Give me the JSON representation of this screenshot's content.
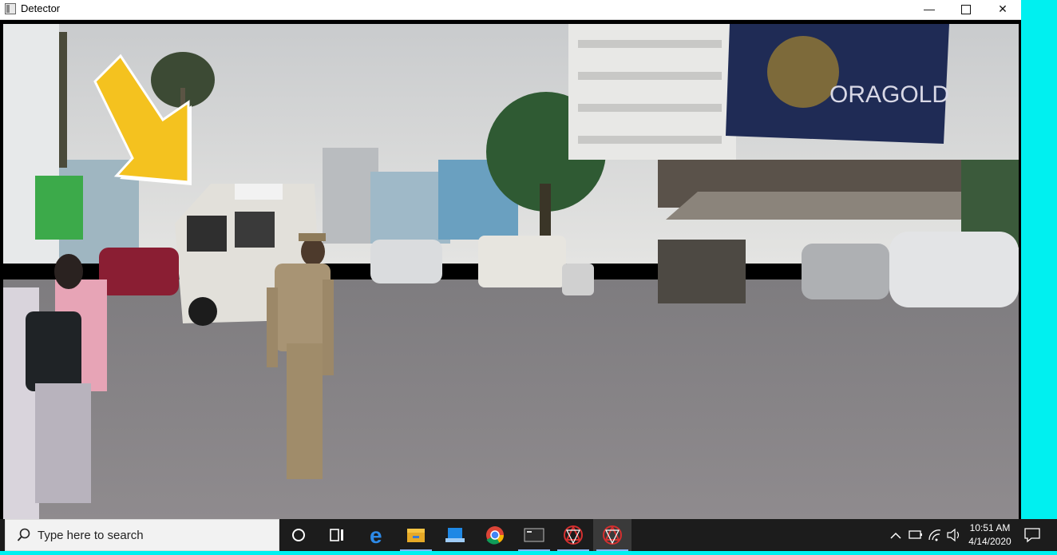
{
  "window": {
    "title": "Detector",
    "minimize_symbol": "—",
    "close_symbol": "✕"
  },
  "video": {
    "billboard_brand": "ORAGOLD"
  },
  "taskbar": {
    "search_placeholder": "Type here to search",
    "clock_time": "10:51 AM",
    "clock_date": "4/14/2020",
    "apps": [
      "cortana-icon",
      "task-view-icon",
      "edge-icon",
      "file-explorer-icon",
      "remote-desktop-icon",
      "chrome-icon",
      "terminal-icon",
      "detector-app-icon",
      "detector-app-icon"
    ]
  },
  "colors": {
    "desktop": "#00f0f0",
    "taskbar": "#1c1c1c",
    "arrow": "#f4c21f"
  }
}
